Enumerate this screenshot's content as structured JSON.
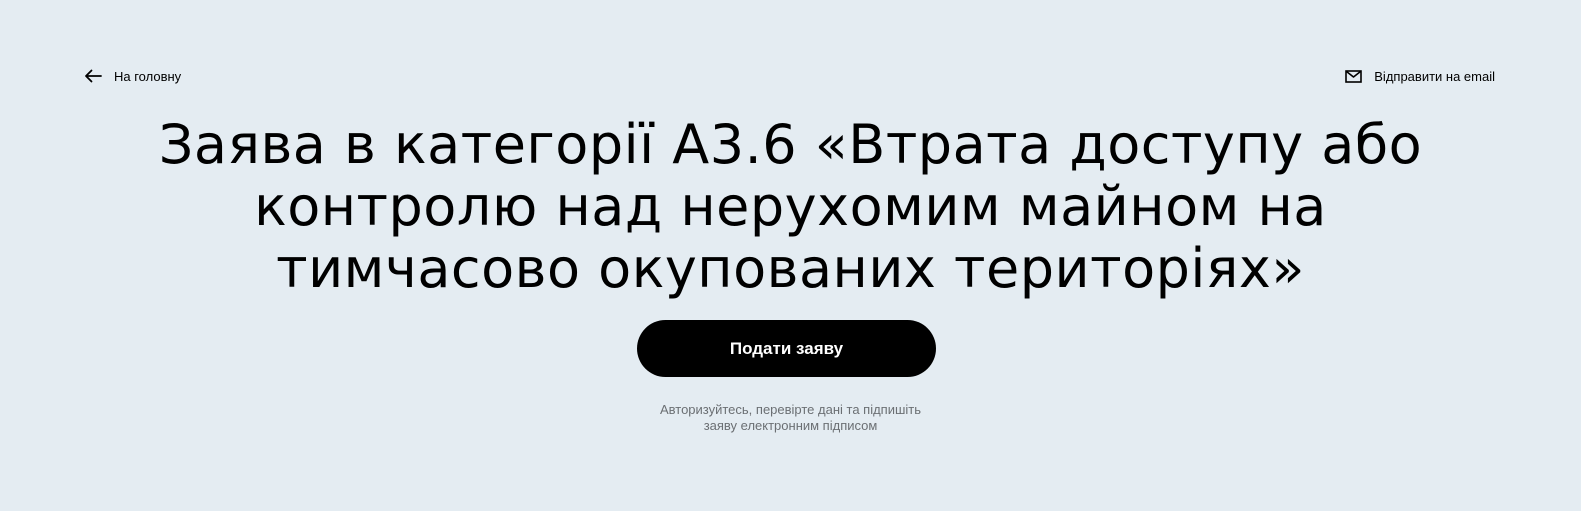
{
  "nav": {
    "back_icon": "arrow-left-icon",
    "back_label": "На головну",
    "email_icon": "envelope-icon",
    "email_label": "Відправити на email"
  },
  "hero": {
    "title_lines": [
      "Заява в категорії А3.6 «Втрата доступу або",
      "контролю над нерухомим майном на",
      "тимчасово окупованих територіях»"
    ],
    "submit_label": "Подати заяву",
    "hint_lines": [
      "Авторизуйтесь, перевірте дані та підпишіть",
      "заяву електронним підписом"
    ]
  },
  "colors": {
    "background": "#e4ecf2",
    "button_background": "#000000",
    "button_text": "#ffffff",
    "hint_text": "#6b6f73"
  }
}
